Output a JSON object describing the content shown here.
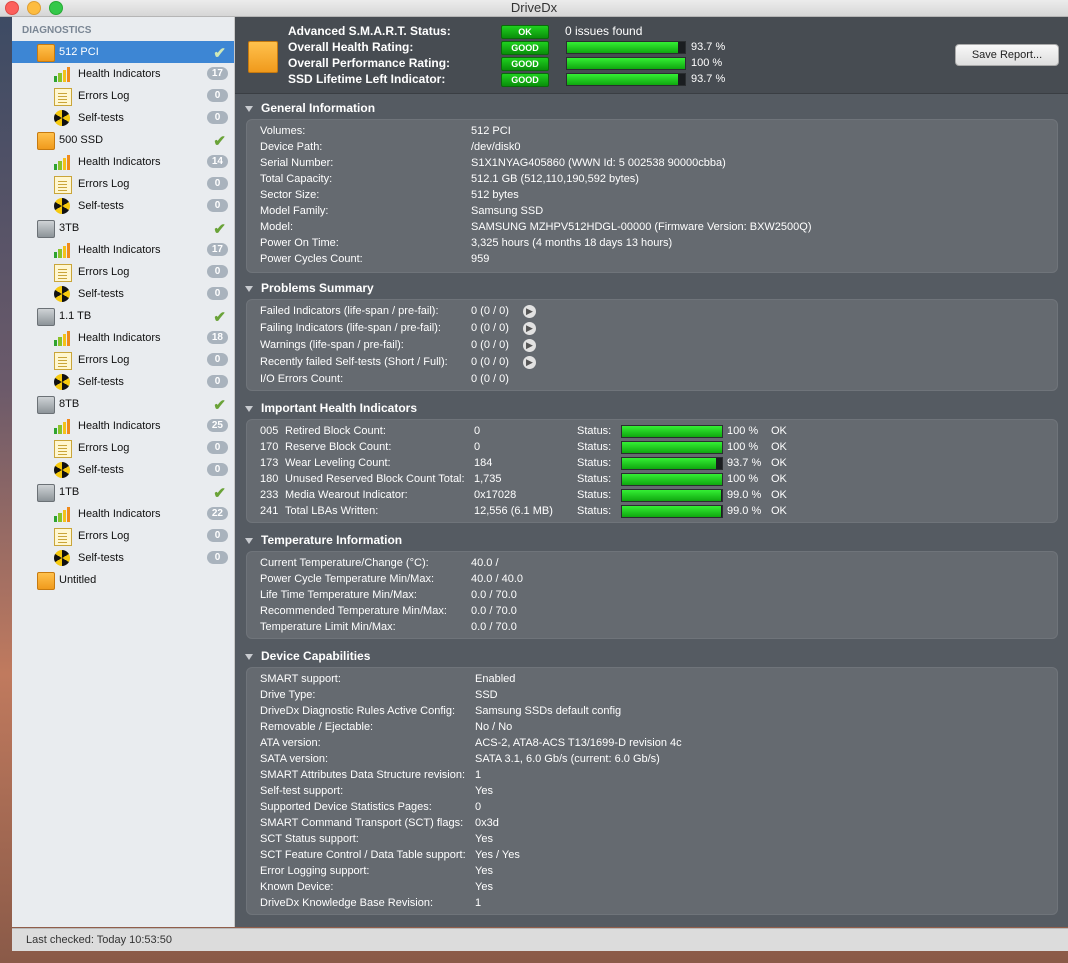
{
  "window": {
    "title": "DriveDx"
  },
  "sidebar": {
    "header": "DIAGNOSTICS",
    "drives": [
      {
        "name": "512 PCI",
        "icon": "drive-orange-icon",
        "healthy": true,
        "children": [
          {
            "label": "Health Indicators",
            "count": "17"
          },
          {
            "label": "Errors Log",
            "count": "0"
          },
          {
            "label": "Self-tests",
            "count": "0"
          }
        ]
      },
      {
        "name": "500 SSD",
        "icon": "drive-orange-icon",
        "healthy": true,
        "children": [
          {
            "label": "Health Indicators",
            "count": "14"
          },
          {
            "label": "Errors Log",
            "count": "0"
          },
          {
            "label": "Self-tests",
            "count": "0"
          }
        ]
      },
      {
        "name": "3TB",
        "icon": "drive-grey-icon",
        "healthy": true,
        "children": [
          {
            "label": "Health Indicators",
            "count": "17"
          },
          {
            "label": "Errors Log",
            "count": "0"
          },
          {
            "label": "Self-tests",
            "count": "0"
          }
        ]
      },
      {
        "name": "1.1 TB",
        "icon": "drive-grey-icon",
        "healthy": true,
        "children": [
          {
            "label": "Health Indicators",
            "count": "18"
          },
          {
            "label": "Errors Log",
            "count": "0"
          },
          {
            "label": "Self-tests",
            "count": "0"
          }
        ]
      },
      {
        "name": "8TB",
        "icon": "drive-grey-icon",
        "healthy": true,
        "children": [
          {
            "label": "Health Indicators",
            "count": "25"
          },
          {
            "label": "Errors Log",
            "count": "0"
          },
          {
            "label": "Self-tests",
            "count": "0"
          }
        ]
      },
      {
        "name": "1TB",
        "icon": "drive-grey-icon",
        "healthy": true,
        "children": [
          {
            "label": "Health Indicators",
            "count": "22"
          },
          {
            "label": "Errors Log",
            "count": "0"
          },
          {
            "label": "Self-tests",
            "count": "0"
          }
        ]
      }
    ],
    "untitled": "Untitled"
  },
  "statusbar": {
    "text": "Last checked: Today 10:53:50"
  },
  "summary": {
    "rows": [
      {
        "label": "Advanced S.M.A.R.T. Status:",
        "pill": "OK",
        "text": "0 issues found"
      },
      {
        "label": "Overall Health Rating:",
        "pill": "GOOD",
        "percent": 93.7,
        "pct_text": "93.7 %"
      },
      {
        "label": "Overall Performance Rating:",
        "pill": "GOOD",
        "percent": 100,
        "pct_text": "100 %"
      },
      {
        "label": "SSD Lifetime Left Indicator:",
        "pill": "GOOD",
        "percent": 93.7,
        "pct_text": "93.7 %"
      }
    ],
    "save_button": "Save Report..."
  },
  "general": {
    "title": "General Information",
    "rows": [
      {
        "k": "Volumes:",
        "v": "512 PCI"
      },
      {
        "k": "Device Path:",
        "v": "/dev/disk0"
      },
      {
        "k": "Serial Number:",
        "v": "S1X1NYAG405860 (WWN Id: 5 002538 90000cbba)"
      },
      {
        "k": "Total Capacity:",
        "v": "512.1 GB (512,110,190,592 bytes)"
      },
      {
        "k": "Sector Size:",
        "v": "512 bytes"
      },
      {
        "k": "Model Family:",
        "v": "Samsung SSD"
      },
      {
        "k": "Model:",
        "v": "SAMSUNG MZHPV512HDGL-00000  (Firmware Version: BXW2500Q)"
      },
      {
        "k": "Power On Time:",
        "v": "3,325 hours (4 months 18 days 13 hours)"
      },
      {
        "k": "Power Cycles Count:",
        "v": "959"
      }
    ]
  },
  "problems": {
    "title": "Problems Summary",
    "rows": [
      {
        "k": "Failed Indicators (life-span / pre-fail):",
        "v": "0  (0 / 0)",
        "btn": true
      },
      {
        "k": "Failing Indicators (life-span / pre-fail):",
        "v": "0  (0 / 0)",
        "btn": true
      },
      {
        "k": "Warnings (life-span / pre-fail):",
        "v": "0  (0 / 0)",
        "btn": true
      },
      {
        "k": "Recently failed Self-tests (Short / Full):",
        "v": "0  (0 / 0)",
        "btn": true
      },
      {
        "k": "I/O Errors Count:",
        "v": "0  (0 / 0)",
        "btn": false
      }
    ]
  },
  "health": {
    "title": "Important Health Indicators",
    "status_label": "Status:",
    "rows": [
      {
        "id": "005",
        "name": "Retired Block Count:",
        "value": "0",
        "percent": 100,
        "pct_text": "100 %",
        "state": "OK"
      },
      {
        "id": "170",
        "name": "Reserve Block Count:",
        "value": "0",
        "percent": 100,
        "pct_text": "100 %",
        "state": "OK"
      },
      {
        "id": "173",
        "name": "Wear Leveling Count:",
        "value": "184",
        "percent": 93.7,
        "pct_text": "93.7 %",
        "state": "OK"
      },
      {
        "id": "180",
        "name": "Unused Reserved Block Count Total:",
        "value": "1,735",
        "percent": 100,
        "pct_text": "100 %",
        "state": "OK"
      },
      {
        "id": "233",
        "name": "Media Wearout Indicator:",
        "value": "0x17028",
        "percent": 99.0,
        "pct_text": "99.0 %",
        "state": "OK"
      },
      {
        "id": "241",
        "name": "Total LBAs Written:",
        "value": "12,556 (6.1 MB)",
        "percent": 99.0,
        "pct_text": "99.0 %",
        "state": "OK"
      }
    ]
  },
  "temperature": {
    "title": "Temperature Information",
    "rows": [
      {
        "k": "Current Temperature/Change (°C):",
        "v": "40.0 /"
      },
      {
        "k": "Power Cycle Temperature Min/Max:",
        "v": "40.0 / 40.0"
      },
      {
        "k": "Life Time Temperature Min/Max:",
        "v": "0.0   / 70.0"
      },
      {
        "k": "Recommended Temperature Min/Max:",
        "v": "0.0   / 70.0"
      },
      {
        "k": "Temperature Limit Min/Max:",
        "v": "0.0   / 70.0"
      }
    ]
  },
  "capabilities": {
    "title": "Device Capabilities",
    "rows": [
      {
        "k": "SMART support:",
        "v": "Enabled"
      },
      {
        "k": "Drive Type:",
        "v": "SSD"
      },
      {
        "k": "DriveDx Diagnostic Rules Active Config:",
        "v": "Samsung SSDs default config"
      },
      {
        "k": "Removable / Ejectable:",
        "v": "No / No"
      },
      {
        "k": "ATA version:",
        "v": "ACS-2, ATA8-ACS T13/1699-D revision 4c"
      },
      {
        "k": "SATA version:",
        "v": "SATA 3.1, 6.0 Gb/s (current: 6.0 Gb/s)"
      },
      {
        "k": "SMART Attributes Data Structure revision:",
        "v": "1"
      },
      {
        "k": "Self-test support:",
        "v": "Yes"
      },
      {
        "k": "Supported Device Statistics Pages:",
        "v": "0"
      },
      {
        "k": "SMART Command Transport (SCT) flags:",
        "v": "0x3d"
      },
      {
        "k": "SCT Status support:",
        "v": "Yes"
      },
      {
        "k": "SCT Feature Control / Data Table support:",
        "v": "Yes / Yes"
      },
      {
        "k": "Error Logging support:",
        "v": "Yes"
      },
      {
        "k": "Known Device:",
        "v": "Yes"
      },
      {
        "k": "DriveDx Knowledge Base Revision:",
        "v": "1"
      }
    ]
  }
}
